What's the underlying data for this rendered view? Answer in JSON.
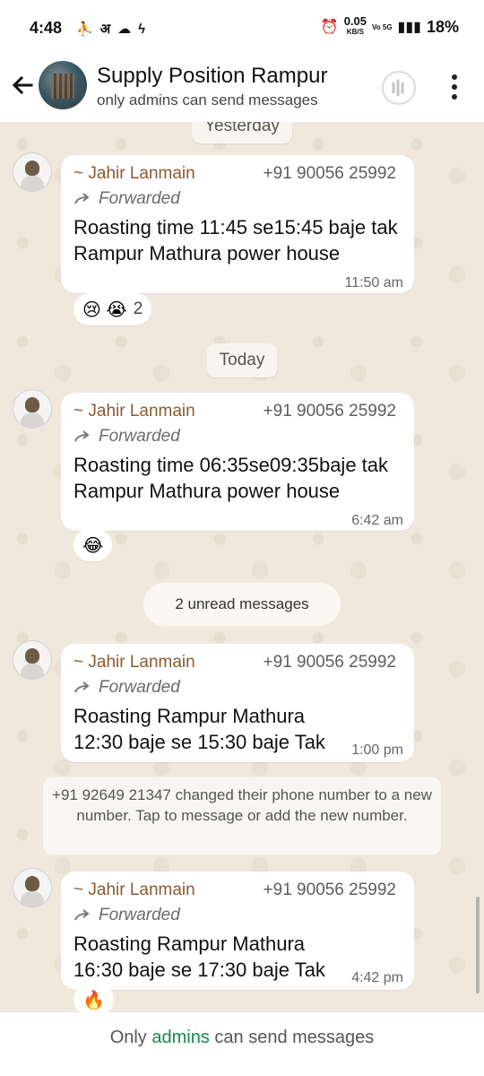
{
  "status": {
    "time": "4:48",
    "left_icons": [
      "person-icon",
      "अ",
      "cloud-icon",
      "bolt-icon"
    ],
    "speed": "0.05",
    "speed_unit": "KB/S",
    "volte": "Vo 5G",
    "network": "5G",
    "battery": "18%"
  },
  "header": {
    "title": "Supply Position Rampur",
    "subtitle": "only admins can send messages"
  },
  "chat": {
    "top_chip": "Yesterday",
    "today_chip": "Today",
    "unread_label": "2 unread messages",
    "messages": [
      {
        "sender": "~ Jahir Lanmain",
        "phone": "+91 90056 25992",
        "forwarded": "Forwarded",
        "text": "Roasting time 11:45 se15:45 baje tak Rampur Mathura power house",
        "time": "11:50 am",
        "reactions": "😢 😭",
        "reaction_count": "2"
      },
      {
        "sender": "~ Jahir Lanmain",
        "phone": "+91 90056 25992",
        "forwarded": "Forwarded",
        "text": "Roasting time 06:35se09:35baje tak Rampur Mathura power house",
        "time": "6:42 am",
        "reactions": "😂"
      },
      {
        "sender": "~ Jahir Lanmain",
        "phone": "+91 90056 25992",
        "forwarded": "Forwarded",
        "text": "Roasting Rampur Mathura 12:30 baje se 15:30 baje Tak",
        "time": "1:00 pm"
      },
      {
        "sender": "~ Jahir Lanmain",
        "phone": "+91 90056 25992",
        "forwarded": "Forwarded",
        "text": "Roasting Rampur Mathura 16:30 baje se 17:30 baje Tak",
        "time": "4:42 pm",
        "reactions": "🔥"
      }
    ],
    "system_message": "+91 92649 21347 changed their phone number to a new number. Tap to message or add the new number."
  },
  "footer": {
    "prefix": "Only ",
    "link": "admins",
    "suffix": " can send messages"
  }
}
